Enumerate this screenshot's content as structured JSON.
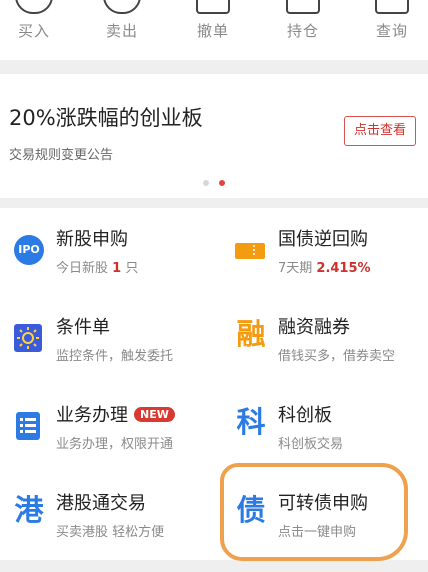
{
  "top_nav": [
    {
      "label": "买入",
      "icon": "buy-icon"
    },
    {
      "label": "卖出",
      "icon": "sell-icon"
    },
    {
      "label": "撤单",
      "icon": "cancel-order-icon"
    },
    {
      "label": "持仓",
      "icon": "holdings-icon"
    },
    {
      "label": "查询",
      "icon": "query-icon"
    }
  ],
  "banner": {
    "title": "20%涨跌幅的创业板",
    "subtitle": "交易规则变更公告",
    "button": "点击查看",
    "dots_active": 2
  },
  "grid": {
    "items": [
      {
        "title": "新股申购",
        "sub_before": "今日新股 ",
        "sub_value": "1",
        "sub_after": " 只",
        "icon": "ipo-icon",
        "icon_text": "IPO"
      },
      {
        "title": "国债逆回购",
        "sub_before": "7天期 ",
        "sub_value": "2.415%",
        "icon": "treasury-ticket-icon"
      },
      {
        "title": "条件单",
        "sub": "监控条件，触发委托",
        "icon": "condition-order-icon"
      },
      {
        "title": "融资融券",
        "sub": "借钱买多，借券卖空",
        "icon": "margin-trading-icon",
        "icon_text": "融"
      },
      {
        "title": "业务办理",
        "badge": "NEW",
        "sub": "业务办理，权限开通",
        "icon": "business-list-icon"
      },
      {
        "title": "科创板",
        "sub": "科创板交易",
        "icon": "star-market-icon",
        "icon_text": "科"
      },
      {
        "title": "港股通交易",
        "sub": "买卖港股 轻松方便",
        "icon": "hk-connect-icon",
        "icon_text": "港"
      },
      {
        "title": "可转债申购",
        "sub": "点击一键申购",
        "icon": "convertible-bond-icon",
        "icon_text": "债"
      }
    ]
  },
  "colors": {
    "accent_red": "#d0312d",
    "icon_blue": "#2c7be5",
    "icon_orange": "#f39c12",
    "annotation_orange": "#f0a14e"
  }
}
